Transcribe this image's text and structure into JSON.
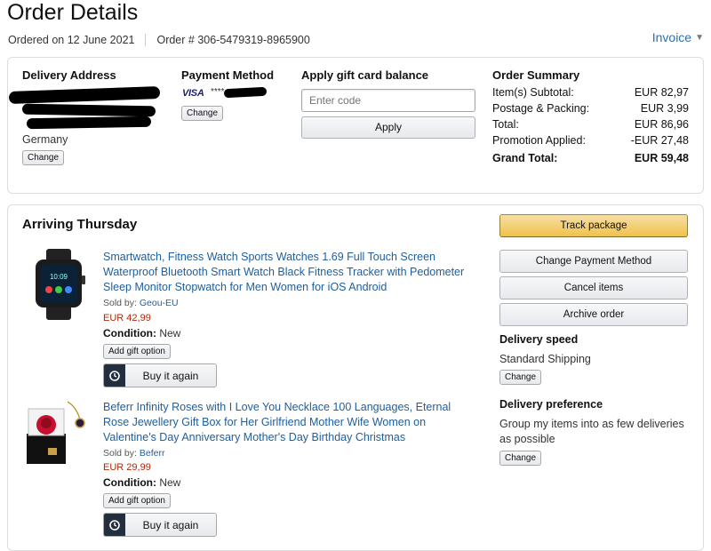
{
  "header": {
    "title": "Order Details",
    "ordered_on": "Ordered on 12 June 2021",
    "order_number": "Order # 306-5479319-8965900",
    "invoice_label": "Invoice"
  },
  "delivery_address": {
    "heading": "Delivery Address",
    "country": "Germany",
    "change_label": "Change"
  },
  "payment_method": {
    "heading": "Payment Method",
    "card_brand": "VISA",
    "card_mask": "****",
    "change_label": "Change"
  },
  "gift_card": {
    "heading": "Apply gift card balance",
    "placeholder": "Enter code",
    "apply_label": "Apply"
  },
  "order_summary": {
    "heading": "Order Summary",
    "rows": [
      {
        "label": "Item(s) Subtotal:",
        "value": "EUR 82,97"
      },
      {
        "label": "Postage & Packing:",
        "value": "EUR 3,99"
      },
      {
        "label": "Total:",
        "value": "EUR 86,96"
      },
      {
        "label": "Promotion Applied:",
        "value": "-EUR 27,48"
      }
    ],
    "grand_total_label": "Grand Total:",
    "grand_total_value": "EUR 59,48"
  },
  "shipment": {
    "heading": "Arriving Thursday",
    "items": [
      {
        "title": "Smartwatch, Fitness Watch Sports Watches 1.69 Full Touch Screen Waterproof Bluetooth Smart Watch Black Fitness Tracker with Pedometer Sleep Monitor Stopwatch for Men Women for iOS Android",
        "sold_by_label": "Sold by:",
        "seller": "Geou-EU",
        "price": "EUR 42,99",
        "condition_label": "Condition:",
        "condition": "New",
        "gift_option_label": "Add gift option",
        "buy_again_label": "Buy it again",
        "image_icon": "smartwatch-image"
      },
      {
        "title": "Beferr Infinity Roses with I Love You Necklace 100 Languages, Eternal Rose Jewellery Gift Box for Her Girlfriend Mother Wife Women on Valentine's Day Anniversary Mother's Day Birthday Christmas",
        "sold_by_label": "Sold by:",
        "seller": "Beferr",
        "price": "EUR 29,99",
        "condition_label": "Condition:",
        "condition": "New",
        "gift_option_label": "Add gift option",
        "buy_again_label": "Buy it again",
        "image_icon": "rose-gift-box-image"
      }
    ]
  },
  "actions": {
    "track_package": "Track package",
    "change_payment": "Change Payment Method",
    "cancel_items": "Cancel items",
    "archive_order": "Archive order"
  },
  "delivery_speed": {
    "heading": "Delivery speed",
    "value": "Standard Shipping",
    "change_label": "Change"
  },
  "delivery_preference": {
    "heading": "Delivery preference",
    "value": "Group my items into as few deliveries as possible",
    "change_label": "Change"
  },
  "colors": {
    "link": "#1e5e9e",
    "price": "#b12704",
    "primary_button": "#f0c14b"
  }
}
